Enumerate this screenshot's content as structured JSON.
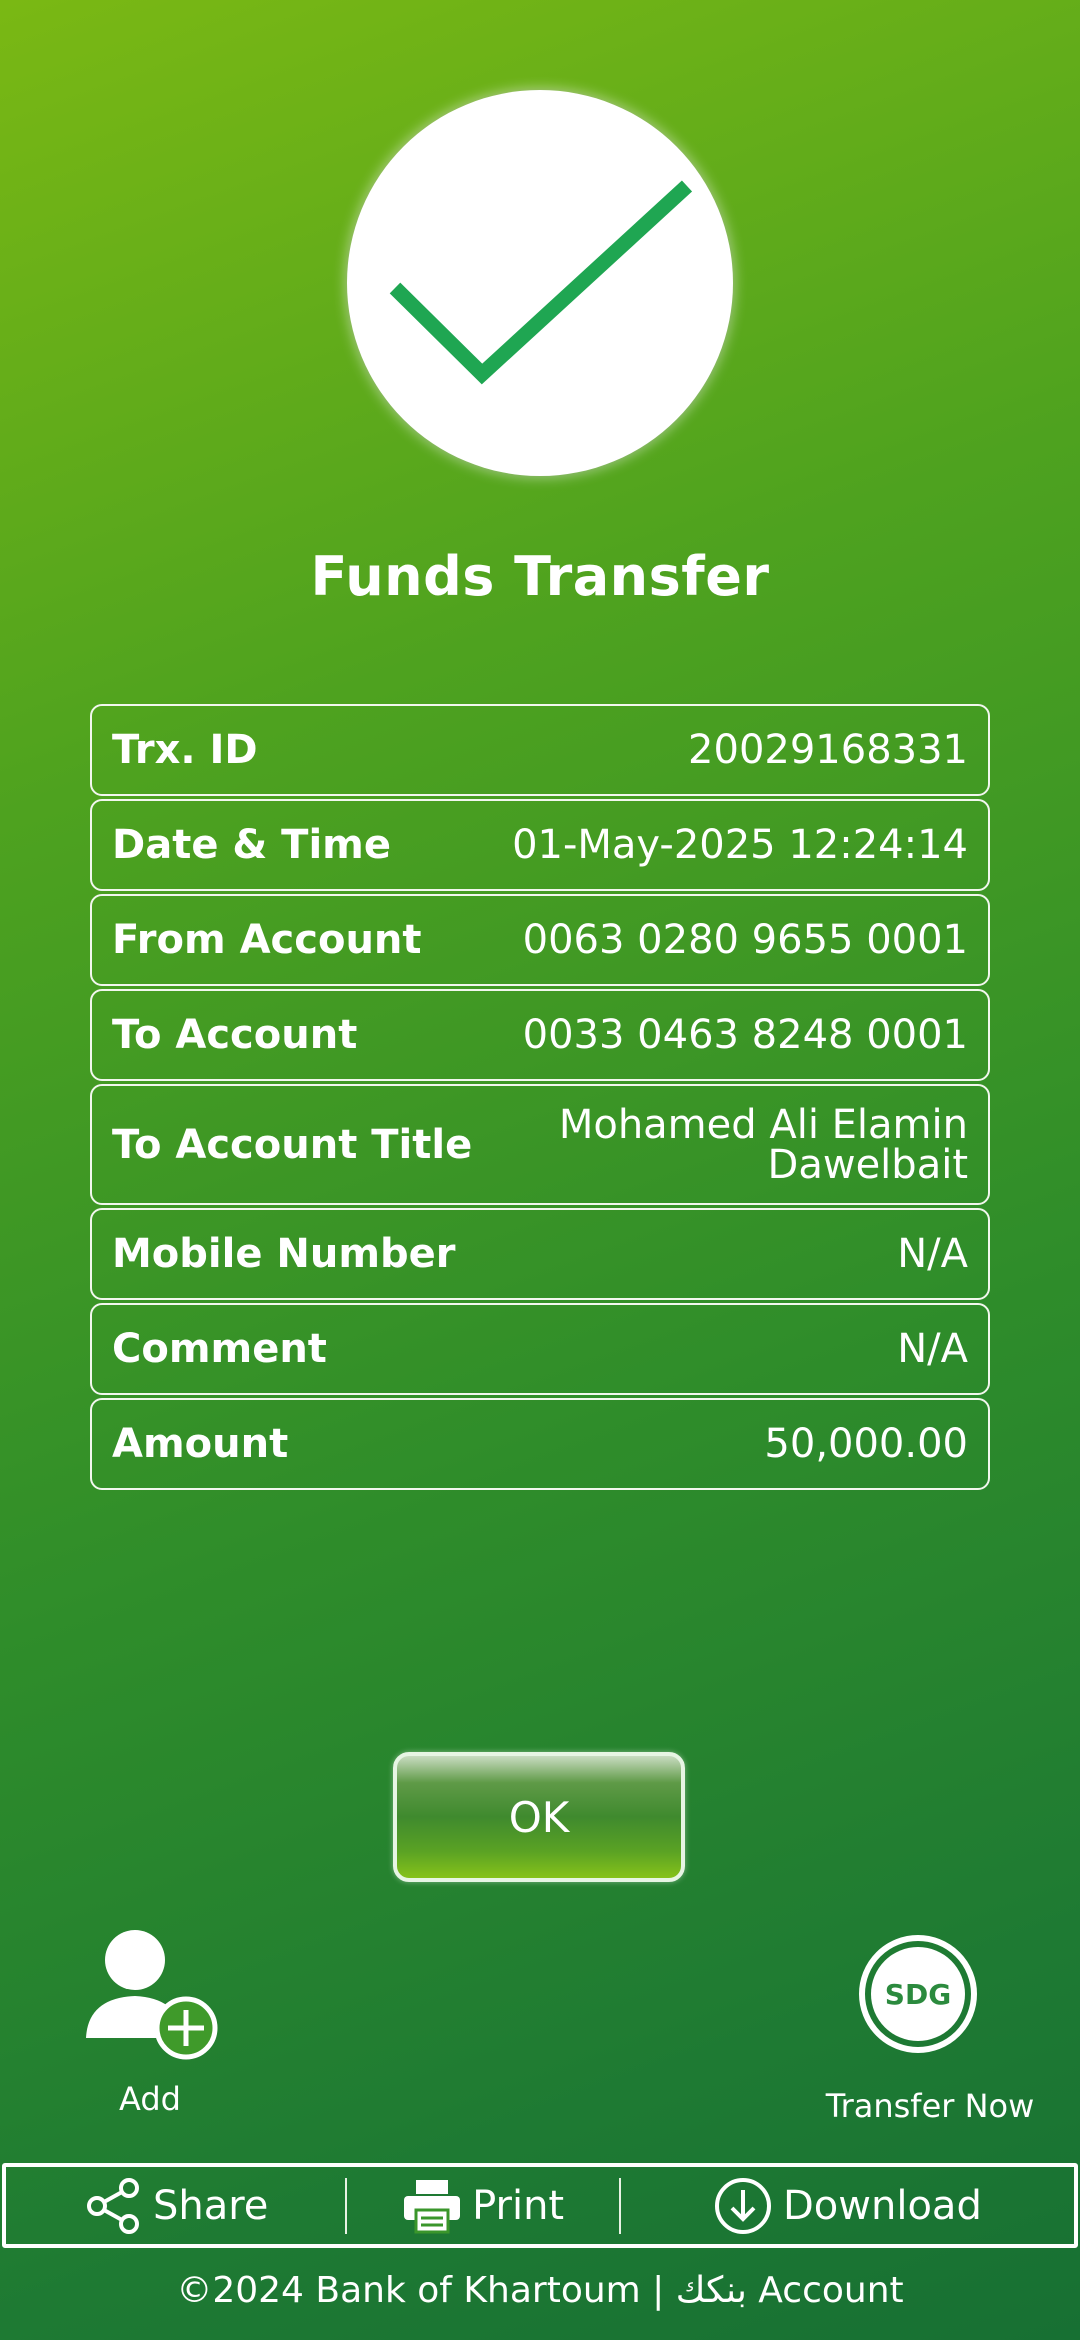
{
  "screen": {
    "title": "Funds Transfer",
    "status_icon": "check-icon",
    "accent_color": "#1fa652"
  },
  "details": [
    {
      "label": "Trx. ID",
      "value": "20029168331"
    },
    {
      "label": "Date & Time",
      "value": "01-May-2025 12:24:14"
    },
    {
      "label": "From Account",
      "value": "0063 0280 9655 0001"
    },
    {
      "label": "To Account",
      "value": "0033 0463 8248 0001"
    },
    {
      "label": "To Account Title",
      "value_line1": "Mohamed Ali Elamin",
      "value_line2": "Dawelbait"
    },
    {
      "label": "Mobile Number",
      "value": "N/A"
    },
    {
      "label": "Comment",
      "value": "N/A"
    },
    {
      "label": "Amount",
      "value": "50,000.00"
    }
  ],
  "ok_button": {
    "label": "OK"
  },
  "add_beneficiary": {
    "label": "Add",
    "icon": "add-user-icon"
  },
  "transfer_now": {
    "label": "Transfer Now",
    "badge": "SDG"
  },
  "actions": {
    "share": {
      "label": "Share",
      "icon": "share-icon"
    },
    "print": {
      "label": "Print",
      "icon": "printer-icon"
    },
    "download": {
      "label": "Download",
      "icon": "download-icon"
    }
  },
  "footer": {
    "text": "©2024 Bank of Khartoum | بنكك Account"
  }
}
